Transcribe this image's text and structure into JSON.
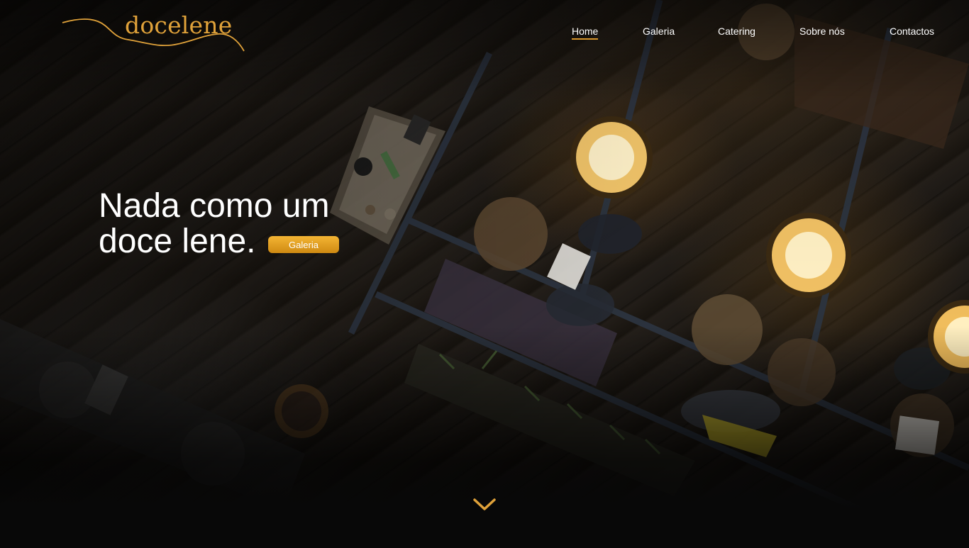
{
  "brand": {
    "logo_text": "docelene",
    "accent_color": "#e0a23a"
  },
  "nav": {
    "items": [
      {
        "label": "Home",
        "active": true
      },
      {
        "label": "Galeria",
        "active": false
      },
      {
        "label": "Catering",
        "active": false
      },
      {
        "label": "Sobre nós",
        "active": false
      },
      {
        "label": "Contactos",
        "active": false
      }
    ]
  },
  "hero": {
    "headline_line1": "Nada como um",
    "headline_line2": "doce lene.",
    "cta_label": "Galeria",
    "cta_color": "#e3a024",
    "background_image": "overhead view of a dimly lit café with pendant lamps and tables"
  },
  "scroll": {
    "icon": "chevron-down-icon",
    "color": "#e0a23a"
  }
}
